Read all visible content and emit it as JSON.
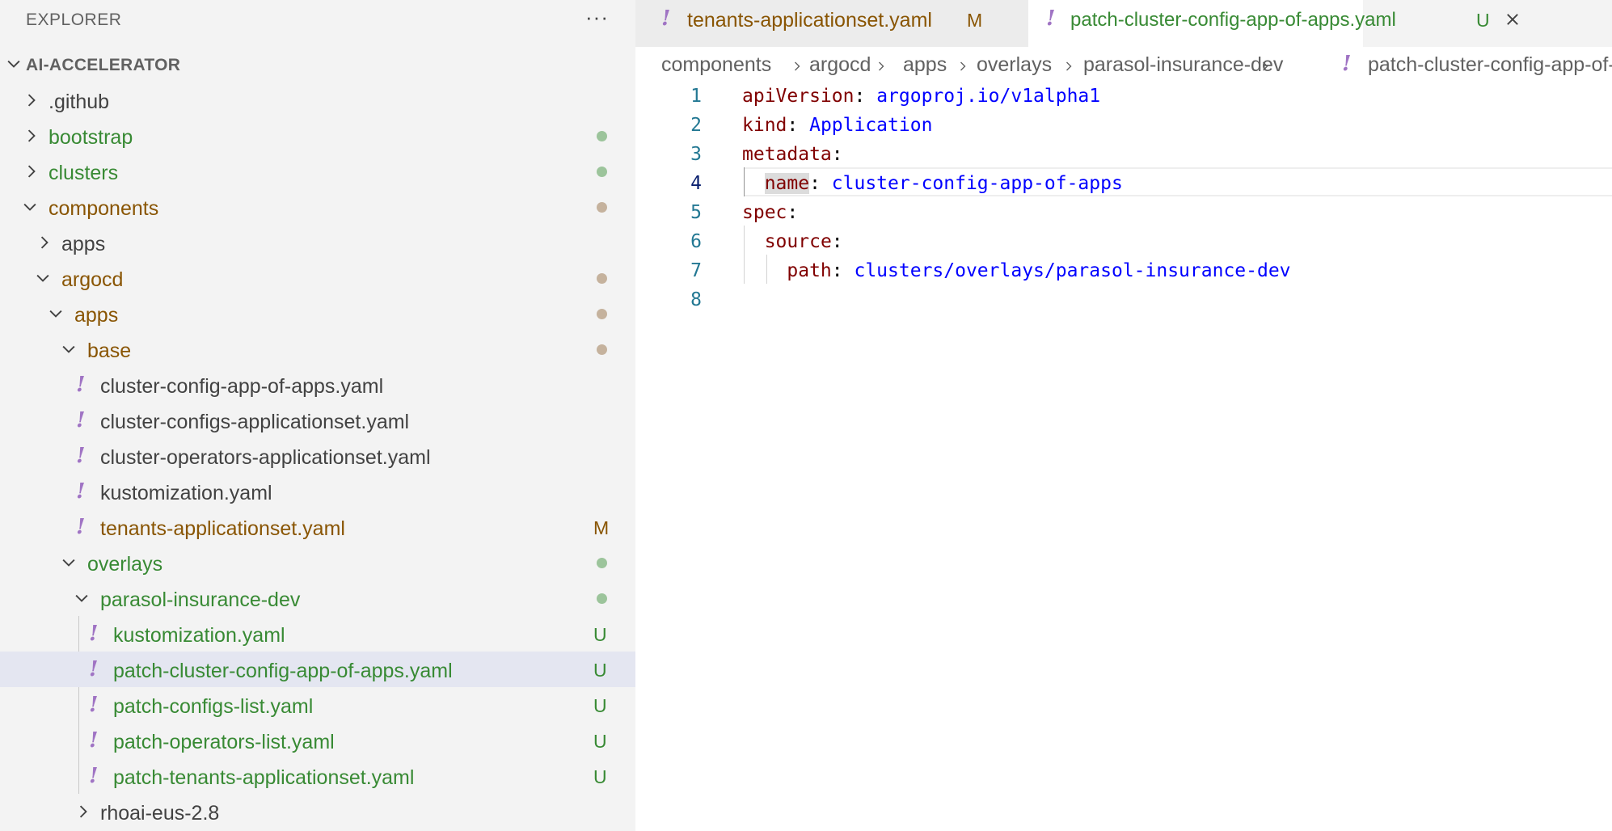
{
  "sidebar": {
    "title": "EXPLORER",
    "more": "···",
    "section_title": "AI-ACCELERATOR",
    "items": [
      {
        "name": ".github",
        "badge": ""
      },
      {
        "name": "bootstrap",
        "badge": ""
      },
      {
        "name": "clusters",
        "badge": ""
      },
      {
        "name": "components",
        "badge": ""
      },
      {
        "name": "apps",
        "badge": ""
      },
      {
        "name": "argocd",
        "badge": ""
      },
      {
        "name": "apps",
        "badge": ""
      },
      {
        "name": "base",
        "badge": ""
      },
      {
        "name": "cluster-config-app-of-apps.yaml",
        "badge": ""
      },
      {
        "name": "cluster-configs-applicationset.yaml",
        "badge": ""
      },
      {
        "name": "cluster-operators-applicationset.yaml",
        "badge": ""
      },
      {
        "name": "kustomization.yaml",
        "badge": ""
      },
      {
        "name": "tenants-applicationset.yaml",
        "badge": "M"
      },
      {
        "name": "overlays",
        "badge": ""
      },
      {
        "name": "parasol-insurance-dev",
        "badge": ""
      },
      {
        "name": "kustomization.yaml",
        "badge": "U"
      },
      {
        "name": "patch-cluster-config-app-of-apps.yaml",
        "badge": "U"
      },
      {
        "name": "patch-configs-list.yaml",
        "badge": "U"
      },
      {
        "name": "patch-operators-list.yaml",
        "badge": "U"
      },
      {
        "name": "patch-tenants-applicationset.yaml",
        "badge": "U"
      },
      {
        "name": "rhoai-eus-2.8",
        "badge": ""
      }
    ]
  },
  "tabs": [
    {
      "label": "tenants-applicationset.yaml",
      "badge": "M"
    },
    {
      "label": "patch-cluster-config-app-of-apps.yaml",
      "badge": "U"
    }
  ],
  "breadcrumb": [
    "components",
    "argocd",
    "apps",
    "overlays",
    "parasol-insurance-dev",
    "patch-cluster-config-app-of-apps.yaml"
  ],
  "editor": {
    "active_line": 4,
    "lines": [
      {
        "n": "1",
        "key": "apiVersion",
        "value": "argoproj.io/v1alpha1"
      },
      {
        "n": "2",
        "key": "kind",
        "value": "Application"
      },
      {
        "n": "3",
        "key": "metadata",
        "value": ""
      },
      {
        "n": "4",
        "key": "name",
        "value": "cluster-config-app-of-apps"
      },
      {
        "n": "5",
        "key": "spec",
        "value": ""
      },
      {
        "n": "6",
        "key": "source",
        "value": ""
      },
      {
        "n": "7",
        "key": "path",
        "value": "clusters/overlays/parasol-insurance-dev"
      },
      {
        "n": "8",
        "key": "",
        "value": ""
      }
    ]
  },
  "colors": {
    "modified": "#895503",
    "untracked": "#388a34",
    "dot_modified": "#c5b29d",
    "dot_untracked": "#9cc49b",
    "yaml_icon": "#a074c4",
    "yaml_key": "#800000",
    "yaml_value": "#0000ff"
  }
}
